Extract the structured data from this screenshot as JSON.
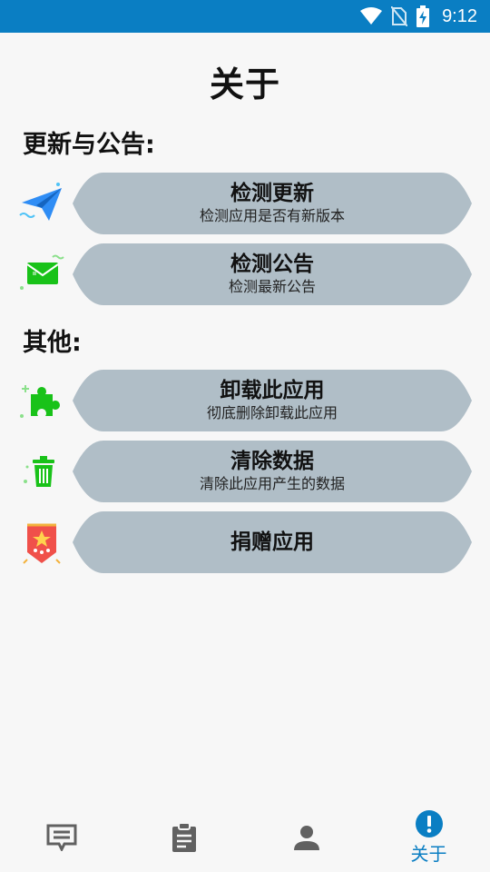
{
  "status_bar": {
    "time": "9:12"
  },
  "page": {
    "title": "关于"
  },
  "sections": [
    {
      "title": "更新与公告:"
    },
    {
      "title": "其他:"
    }
  ],
  "items": [
    {
      "title": "检测更新",
      "subtitle": "检测应用是否有新版本",
      "icon": "paper-plane-icon"
    },
    {
      "title": "检测公告",
      "subtitle": "检测最新公告",
      "icon": "mail-icon"
    },
    {
      "title": "卸载此应用",
      "subtitle": "彻底删除卸载此应用",
      "icon": "puzzle-icon"
    },
    {
      "title": "清除数据",
      "subtitle": "清除此应用产生的数据",
      "icon": "trash-icon"
    },
    {
      "title": "捐赠应用",
      "subtitle": "",
      "icon": "pennant-icon"
    }
  ],
  "bottom_nav": {
    "items": [
      {
        "icon": "message-list-icon",
        "label": ""
      },
      {
        "icon": "clipboard-icon",
        "label": ""
      },
      {
        "icon": "person-icon",
        "label": ""
      },
      {
        "icon": "info-icon",
        "label": "关于",
        "active": true
      }
    ]
  },
  "colors": {
    "status_bar": "#0a7ec3",
    "pill": "#b0bec7",
    "accent": "#0a7ec3",
    "icon_green": "#19c219"
  }
}
